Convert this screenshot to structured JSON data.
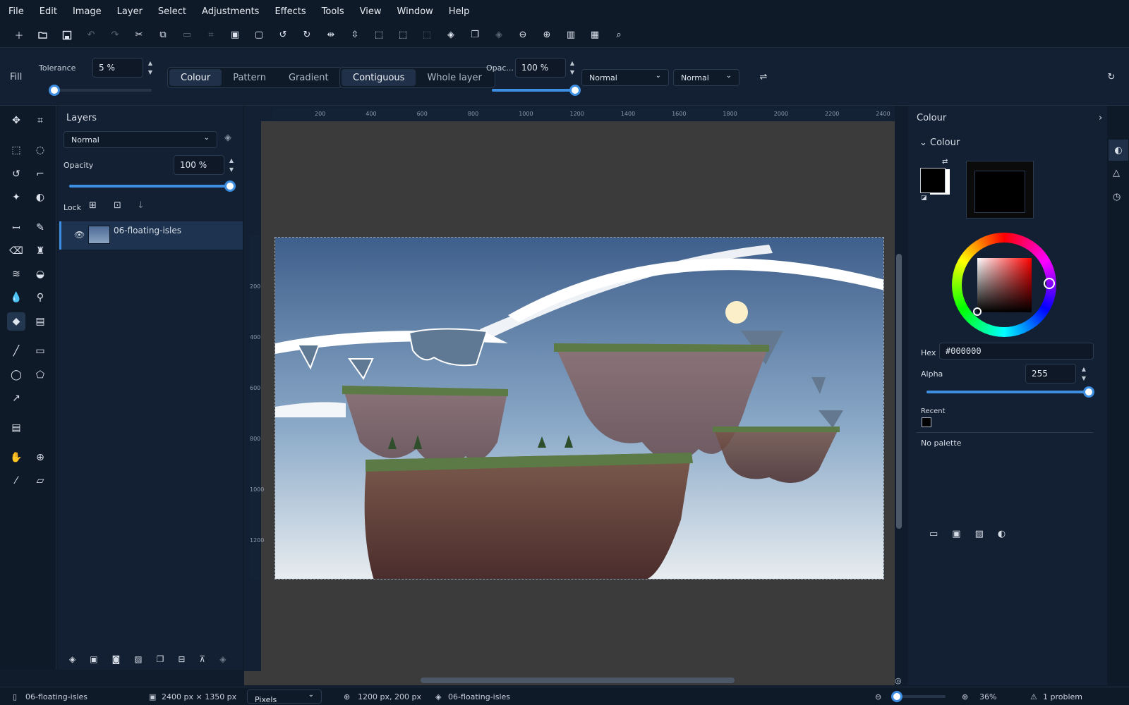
{
  "menu": [
    "File",
    "Edit",
    "Image",
    "Layer",
    "Select",
    "Adjustments",
    "Effects",
    "Tools",
    "View",
    "Window",
    "Help"
  ],
  "toolopts": {
    "tool_name": "Fill",
    "tolerance_label": "Tolerance",
    "tolerance_value": "5 %",
    "mode_options": [
      "Colour",
      "Pattern",
      "Gradient"
    ],
    "mode_selected": "Colour",
    "flood_options": [
      "Contiguous",
      "Whole layer"
    ],
    "flood_selected": "Contiguous",
    "opacity_label": "Opac...",
    "opacity_value": "100 %",
    "blend1": "Normal",
    "blend2": "Normal",
    "tolerance_fraction": 0.05,
    "opacity_fraction": 1.0
  },
  "layers": {
    "title": "Layers",
    "blend": "Normal",
    "opacity_label": "Opacity",
    "opacity_value": "100 %",
    "lock_label": "Lock",
    "items": [
      {
        "name": "06-floating-isles",
        "visible": true,
        "selected": true
      }
    ]
  },
  "ruler": {
    "h": [
      "200",
      "400",
      "600",
      "800",
      "1000",
      "1200",
      "1400",
      "1600",
      "1800",
      "2000",
      "2200",
      "2400"
    ],
    "v": [
      "200",
      "400",
      "600",
      "800",
      "1000",
      "1200"
    ]
  },
  "colour": {
    "panel_title": "Colour",
    "section_title": "Colour",
    "hex_label": "Hex",
    "hex_value": "#000000",
    "alpha_label": "Alpha",
    "alpha_value": "255",
    "recent_label": "Recent",
    "palette_text": "No palette",
    "primary": "#000000",
    "secondary": "#ffffff"
  },
  "status": {
    "doc": "06-floating-isles",
    "size": "2400 px × 1350 px",
    "units": "Pixels",
    "pos": "1200 px, 200 px",
    "layer": "06-floating-isles",
    "zoom": "36%",
    "problems": "1 problem"
  },
  "colors": {
    "accent": "#3d8de0",
    "bg": "#101c2c"
  }
}
